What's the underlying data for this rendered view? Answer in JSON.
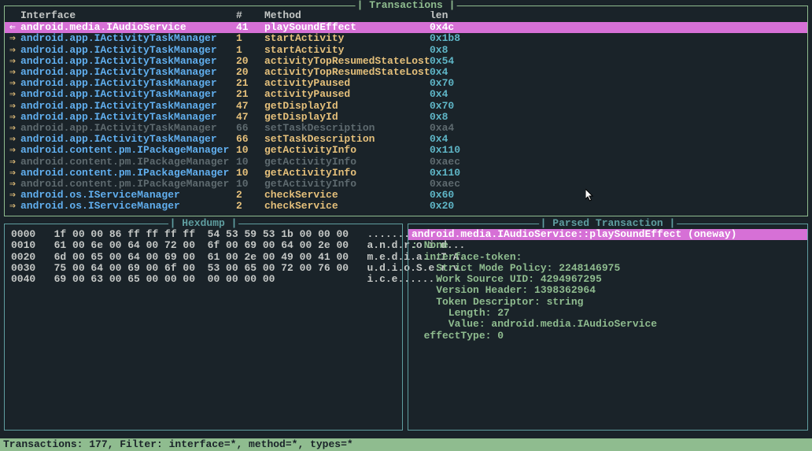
{
  "panels": {
    "transactions_title": "Transactions",
    "hexdump_title": "Hexdump",
    "parsed_title": "Parsed Transaction"
  },
  "header": {
    "interface": "Interface",
    "num": "#",
    "method": "Method",
    "len": "len"
  },
  "rows": [
    {
      "arrow": "⇐",
      "iface": "android.media.IAudioService",
      "num": "41",
      "method": "playSoundEffect",
      "len": "0x4c",
      "sel": true,
      "dim": false
    },
    {
      "arrow": "⇒",
      "iface": "android.app.IActivityTaskManager",
      "num": "1",
      "method": "startActivity",
      "len": "0x1b8",
      "sel": false,
      "dim": false
    },
    {
      "arrow": "⇒",
      "iface": "android.app.IActivityTaskManager",
      "num": "1",
      "method": "startActivity",
      "len": "0x8",
      "sel": false,
      "dim": false
    },
    {
      "arrow": "⇒",
      "iface": "android.app.IActivityTaskManager",
      "num": "20",
      "method": "activityTopResumedStateLost",
      "len": "0x54",
      "sel": false,
      "dim": false
    },
    {
      "arrow": "⇒",
      "iface": "android.app.IActivityTaskManager",
      "num": "20",
      "method": "activityTopResumedStateLost",
      "len": "0x4",
      "sel": false,
      "dim": false
    },
    {
      "arrow": "⇒",
      "iface": "android.app.IActivityTaskManager",
      "num": "21",
      "method": "activityPaused",
      "len": "0x70",
      "sel": false,
      "dim": false
    },
    {
      "arrow": "⇒",
      "iface": "android.app.IActivityTaskManager",
      "num": "21",
      "method": "activityPaused",
      "len": "0x4",
      "sel": false,
      "dim": false
    },
    {
      "arrow": "⇒",
      "iface": "android.app.IActivityTaskManager",
      "num": "47",
      "method": "getDisplayId",
      "len": "0x70",
      "sel": false,
      "dim": false
    },
    {
      "arrow": "⇒",
      "iface": "android.app.IActivityTaskManager",
      "num": "47",
      "method": "getDisplayId",
      "len": "0x8",
      "sel": false,
      "dim": false
    },
    {
      "arrow": "⇒",
      "iface": "android.app.IActivityTaskManager",
      "num": "66",
      "method": "setTaskDescription",
      "len": "0xa4",
      "sel": false,
      "dim": true
    },
    {
      "arrow": "⇒",
      "iface": "android.app.IActivityTaskManager",
      "num": "66",
      "method": "setTaskDescription",
      "len": "0x4",
      "sel": false,
      "dim": false
    },
    {
      "arrow": "⇒",
      "iface": "android.content.pm.IPackageManager",
      "num": "10",
      "method": "getActivityInfo",
      "len": "0x110",
      "sel": false,
      "dim": false
    },
    {
      "arrow": "⇒",
      "iface": "android.content.pm.IPackageManager",
      "num": "10",
      "method": "getActivityInfo",
      "len": "0xaec",
      "sel": false,
      "dim": true
    },
    {
      "arrow": "⇒",
      "iface": "android.content.pm.IPackageManager",
      "num": "10",
      "method": "getActivityInfo",
      "len": "0x110",
      "sel": false,
      "dim": false
    },
    {
      "arrow": "⇒",
      "iface": "android.content.pm.IPackageManager",
      "num": "10",
      "method": "getActivityInfo",
      "len": "0xaec",
      "sel": false,
      "dim": true
    },
    {
      "arrow": "⇒",
      "iface": "android.os.IServiceManager",
      "num": "2",
      "method": "checkService",
      "len": "0x60",
      "sel": false,
      "dim": false
    },
    {
      "arrow": "⇒",
      "iface": "android.os.IServiceManager",
      "num": "2",
      "method": "checkService",
      "len": "0x20",
      "sel": false,
      "dim": false
    }
  ],
  "hexdump": [
    "0000   1f 00 00 86 ff ff ff ff  54 53 59 53 1b 00 00 00   ........TSYS....",
    "0010   61 00 6e 00 64 00 72 00  6f 00 69 00 64 00 2e 00   a.n.d.r.o.i.d...",
    "0020   6d 00 65 00 64 00 69 00  61 00 2e 00 49 00 41 00   m.e.d.i.a...I.A.",
    "0030   75 00 64 00 69 00 6f 00  53 00 65 00 72 00 76 00   u.d.i.o.S.e.r.v.",
    "0040   69 00 63 00 65 00 00 00  00 00 00 00               i.c.e......."
  ],
  "parsed": {
    "header": "android.media.IAudioService::playSoundEffect (oneway)",
    "lines": [
      ": None",
      "  interface-token:",
      "    Strict Mode Policy: 2248146975",
      "    Work Source UID: 4294967295",
      "    Version Header: 1398362964",
      "    Token Descriptor: string",
      "      Length: 27",
      "      Value: android.media.IAudioService",
      "  effectType: 0"
    ]
  },
  "statusbar": "Transactions: 177, Filter: interface=*, method=*, types=*"
}
